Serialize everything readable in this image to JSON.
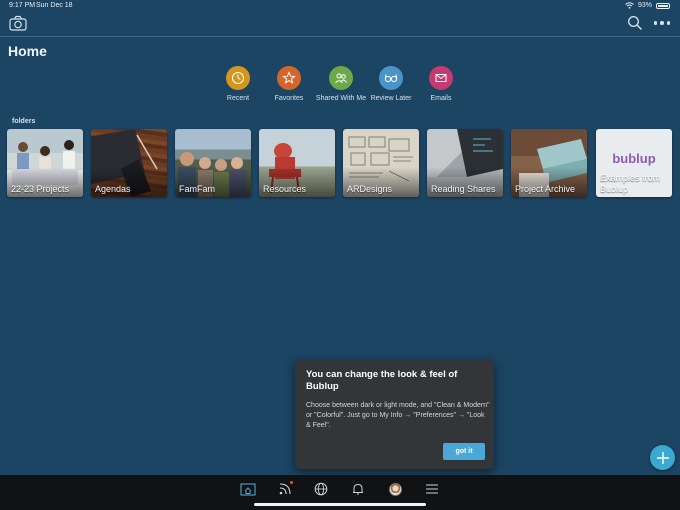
{
  "status_bar": {
    "time": "9:17 PM",
    "date": "Sun Dec 18",
    "battery": "93%"
  },
  "page": {
    "title": "Home"
  },
  "quick_links": [
    {
      "label": "Recent",
      "icon": "clock-icon",
      "color": "#d3971d"
    },
    {
      "label": "Favorites",
      "icon": "star-icon",
      "color": "#d4662a"
    },
    {
      "label": "Shared With Me",
      "icon": "people-icon",
      "color": "#6ea84b"
    },
    {
      "label": "Review Later",
      "icon": "glasses-icon",
      "color": "#4b95c6"
    },
    {
      "label": "Emails",
      "icon": "envelope-icon",
      "color": "#c43b6f"
    }
  ],
  "folders_label": "folders",
  "folders": [
    {
      "label": "22-23 Projects"
    },
    {
      "label": "Agendas"
    },
    {
      "label": "FamFam"
    },
    {
      "label": "Resources"
    },
    {
      "label": "ARDesigns"
    },
    {
      "label": "Reading Shares"
    },
    {
      "label": "Project Archive"
    },
    {
      "label": "Examples from Bublup",
      "logo_text": "bublup"
    }
  ],
  "tooltip": {
    "title": "You can change the look & feel of Bublup",
    "body": "Choose between dark or light mode, and \"Clean & Modern\" or \"Colorful\". Just go to My Info → \"Preferences\" → \"Look & Feel\".",
    "button": "got it"
  },
  "colors": {
    "background": "#1c4463",
    "accent": "#49a8d8",
    "bottom_bar": "#111213"
  }
}
